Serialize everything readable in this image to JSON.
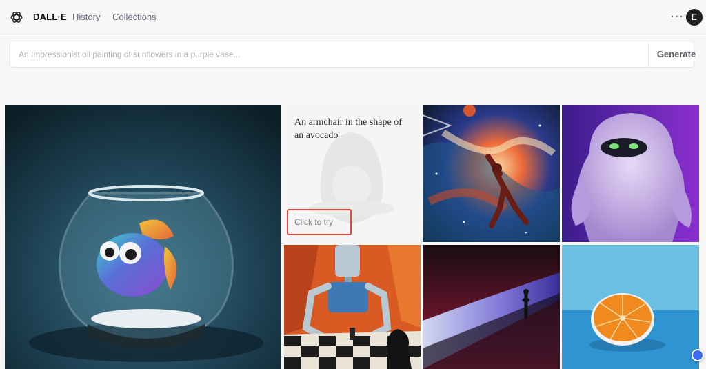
{
  "header": {
    "brand": "DALL·E",
    "nav": {
      "history": "History",
      "collections": "Collections"
    },
    "more_label": "···",
    "avatar_initial": "E"
  },
  "prompt": {
    "placeholder": "An Impressionist oil painting of sunflowers in a purple vase...",
    "value": "",
    "generate_label": "Generate"
  },
  "gallery": {
    "featured_caption": "An armchair in the shape of an avocado",
    "try_label": "Click to try",
    "accent_color": "#e0463b",
    "tiles": [
      {
        "icon": "fishbowl-image"
      },
      {
        "icon": "avocado-armchair-image"
      },
      {
        "icon": "space-basketball-image"
      },
      {
        "icon": "purple-yeti-image"
      },
      {
        "icon": "robot-chess-image"
      },
      {
        "icon": "light-wave-image"
      },
      {
        "icon": "orange-half-image"
      }
    ]
  }
}
